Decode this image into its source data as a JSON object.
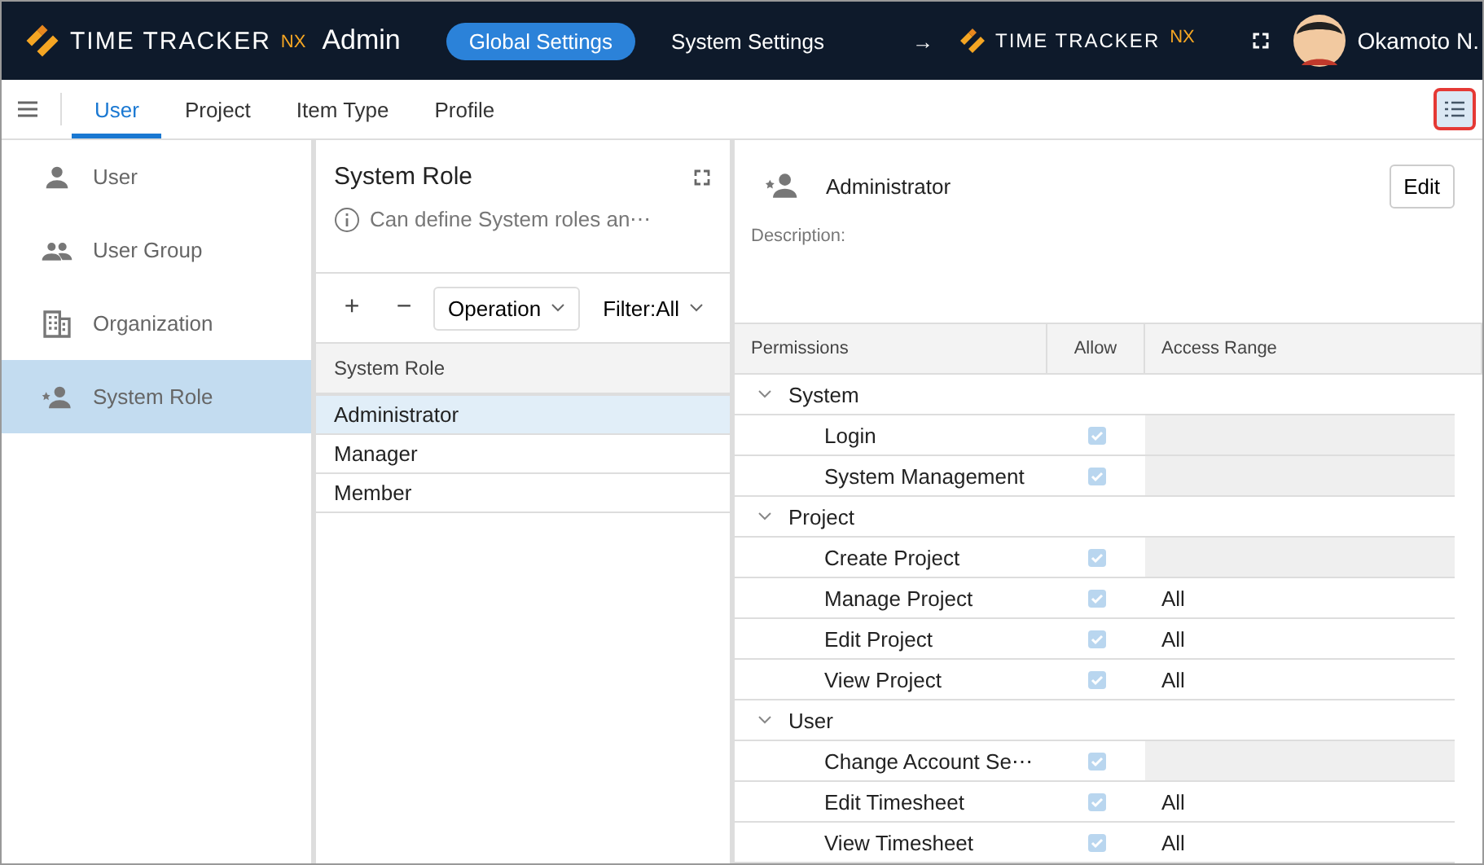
{
  "header": {
    "logo": {
      "brand": "TIME TRACKER",
      "suffix": "NX",
      "product": "Admin"
    },
    "nav": [
      {
        "label": "Global Settings",
        "selected": true
      },
      {
        "label": "System Settings",
        "selected": false
      }
    ],
    "link_logo": {
      "arrow": "→",
      "brand": "TIME TRACKER",
      "suffix": "NX"
    },
    "user": "Okamoto N."
  },
  "tabs": [
    {
      "label": "User",
      "selected": true
    },
    {
      "label": "Project",
      "selected": false
    },
    {
      "label": "Item Type",
      "selected": false
    },
    {
      "label": "Profile",
      "selected": false
    }
  ],
  "sidebar": {
    "items": [
      {
        "label": "User",
        "kind": "user",
        "selected": false
      },
      {
        "label": "User Group",
        "kind": "group",
        "selected": false
      },
      {
        "label": "Organization",
        "kind": "building",
        "selected": false
      },
      {
        "label": "System Role",
        "kind": "role",
        "selected": true
      }
    ]
  },
  "role_list": {
    "title": "System Role",
    "info": "Can define System roles an⋯",
    "add": "+",
    "remove": "−",
    "operation": "Operation",
    "filter": "Filter:All",
    "column": "System Role",
    "rows": [
      {
        "name": "Administrator",
        "selected": true
      },
      {
        "name": "Manager",
        "selected": false
      },
      {
        "name": "Member",
        "selected": false
      }
    ]
  },
  "detail": {
    "name": "Administrator",
    "edit": "Edit",
    "description_label": "Description:",
    "columns": [
      "Permissions",
      "Allow",
      "Access Range"
    ],
    "groups": [
      {
        "name": "System",
        "expanded": true,
        "children": [
          {
            "name": "Login",
            "allowed": true
          },
          {
            "name": "System Management",
            "allowed": true
          }
        ]
      },
      {
        "name": "Project",
        "expanded": true,
        "children": [
          {
            "name": "Create Project",
            "allowed": true
          },
          {
            "name": "Manage Project",
            "allowed": true,
            "range": "All"
          },
          {
            "name": "Edit Project",
            "allowed": true,
            "range": "All"
          },
          {
            "name": "View Project",
            "allowed": true,
            "range": "All"
          }
        ]
      },
      {
        "name": "User",
        "expanded": true,
        "children": [
          {
            "name": "Change Account Se⋯",
            "allowed": true
          },
          {
            "name": "Edit Timesheet",
            "allowed": true,
            "range": "All"
          },
          {
            "name": "View Timesheet",
            "allowed": true,
            "range": "All"
          }
        ]
      }
    ]
  }
}
